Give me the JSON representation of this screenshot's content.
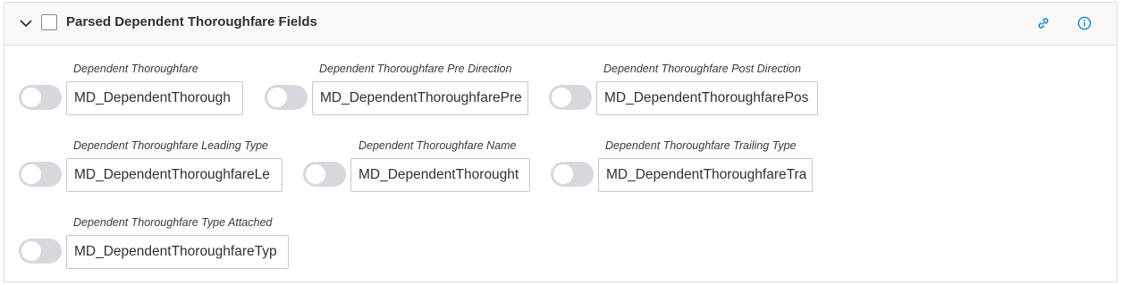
{
  "section": {
    "title": "Parsed Dependent Thoroughfare Fields",
    "expanded": true,
    "checked": false,
    "icons": [
      "chevron-down-icon",
      "link-icon",
      "info-icon"
    ],
    "accent_color": "#0078d4"
  },
  "fields": [
    {
      "label": "Dependent Thoroughfare",
      "value": "MD_DependentThorough",
      "enabled": false
    },
    {
      "label": "Dependent Thoroughfare Pre Direction",
      "value": "MD_DependentThoroughfarePre",
      "enabled": false
    },
    {
      "label": "Dependent Thoroughfare Post Direction",
      "value": "MD_DependentThoroughfarePos",
      "enabled": false
    },
    {
      "label": "Dependent Thoroughfare Leading Type",
      "value": "MD_DependentThoroughfareLe",
      "enabled": false
    },
    {
      "label": "Dependent Thoroughfare Name",
      "value": "MD_DependentThorought",
      "enabled": false
    },
    {
      "label": "Dependent Thoroughfare Trailing Type",
      "value": "MD_DependentThoroughfareTra",
      "enabled": false
    },
    {
      "label": "Dependent Thoroughfare Type Attached",
      "value": "MD_DependentThoroughfareTyp",
      "enabled": false
    }
  ]
}
